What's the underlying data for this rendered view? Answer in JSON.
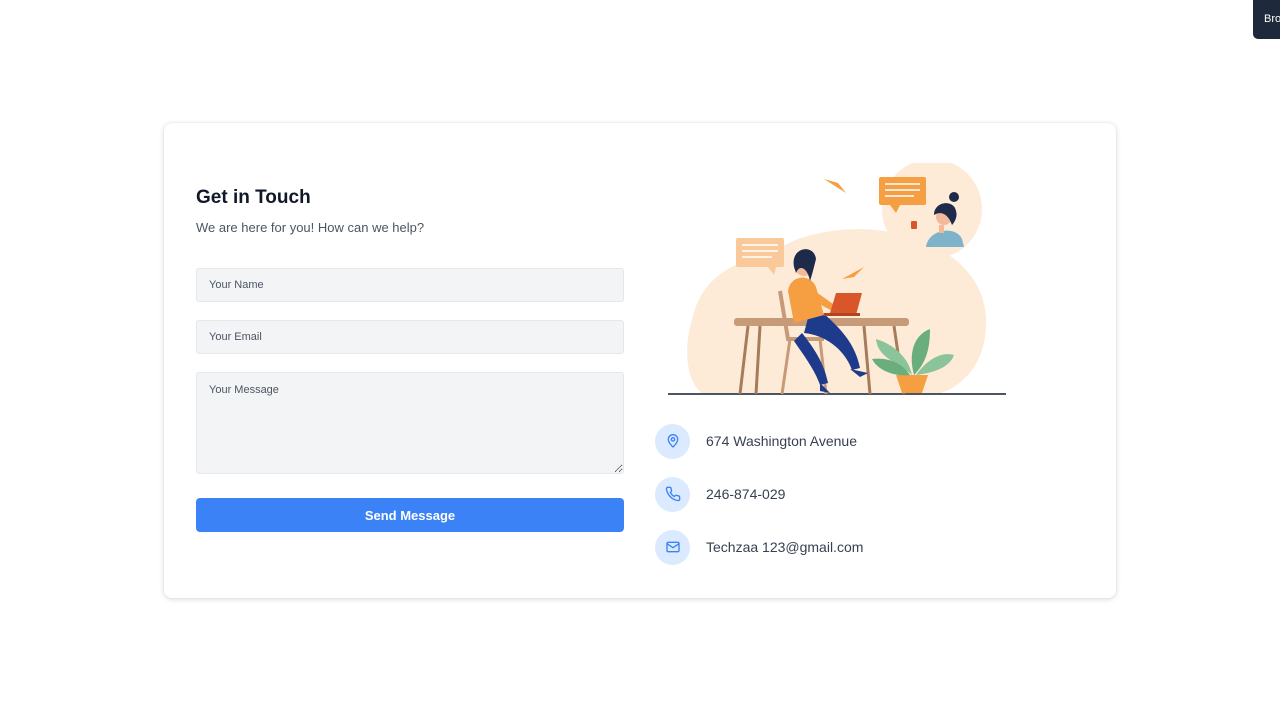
{
  "corner_tab": {
    "label": "Bro"
  },
  "contact": {
    "title": "Get in Touch",
    "subtitle": "We are here for you! How can we help?",
    "form": {
      "name_placeholder": "Your Name",
      "email_placeholder": "Your Email",
      "message_placeholder": "Your Message",
      "submit_label": "Send Message"
    },
    "info": {
      "address": "674 Washington Avenue",
      "phone": "246-874-029",
      "email": "Techzaa 123@gmail.com"
    }
  },
  "colors": {
    "accent": "#3b82f6",
    "icon_bg": "#dbeafe",
    "field_bg": "#f3f4f6",
    "illustration_blob": "#fdebd8",
    "illustration_orange": "#f59e42"
  },
  "icons": {
    "address": "map-pin-icon",
    "phone": "phone-icon",
    "email": "mail-icon"
  }
}
